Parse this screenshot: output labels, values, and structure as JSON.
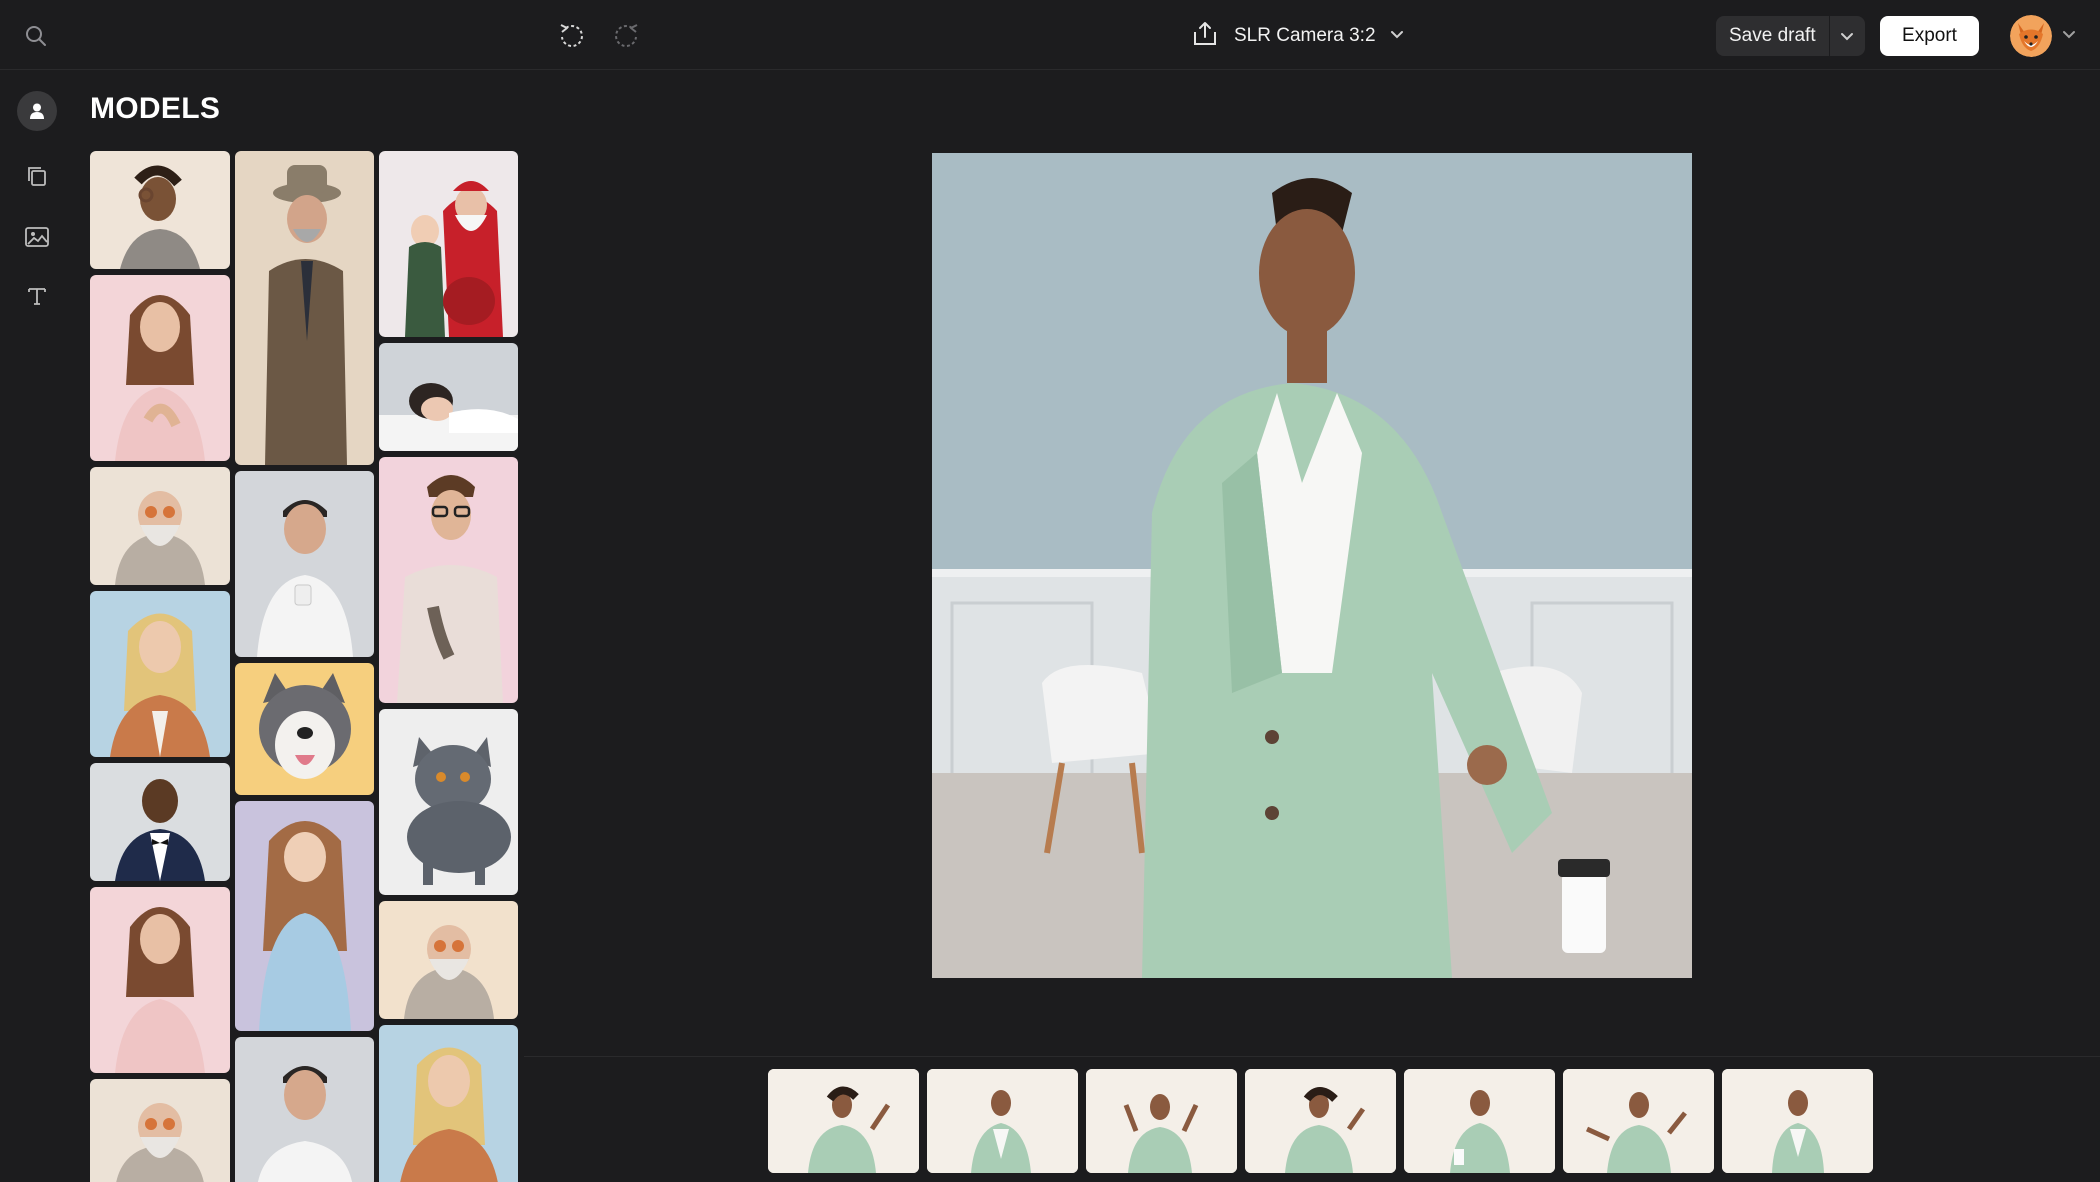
{
  "topbar": {
    "document_title": "SLR Camera 3:2",
    "save_draft_label": "Save draft",
    "export_label": "Export"
  },
  "panel": {
    "title": "MODELS"
  },
  "icons": {
    "search": "search-icon",
    "undo": "undo-icon",
    "redo": "redo-icon",
    "share": "share-icon",
    "chevron": "chevron-down-icon",
    "models": "person-icon",
    "layouts": "layers-icon",
    "backgrounds": "image-icon",
    "text": "text-icon",
    "avatar": "fox-avatar"
  },
  "colors": {
    "background": "#1c1c1e",
    "surface": "#2e2e30",
    "accent_white": "#ffffff"
  }
}
